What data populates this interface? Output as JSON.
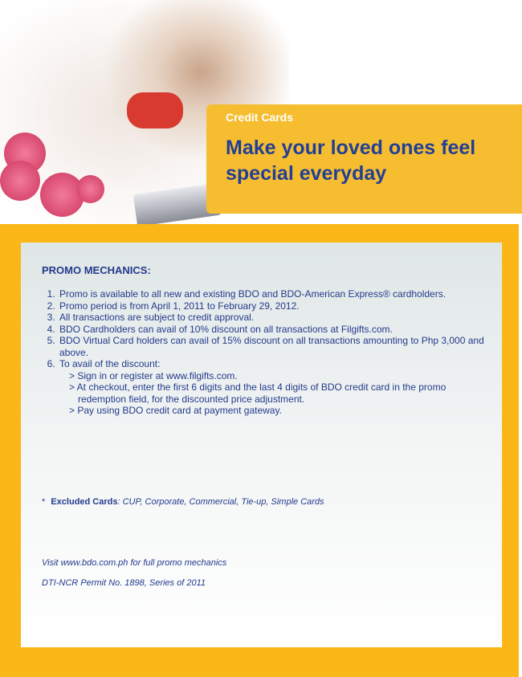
{
  "banner": {
    "kicker": "Credit Cards",
    "headline": "Make your loved ones feel special everyday"
  },
  "promo": {
    "heading": "PROMO MECHANICS:",
    "items": [
      "Promo is available to all new and existing BDO and BDO-American Express® cardholders.",
      "Promo period is from April 1, 2011 to February 29, 2012.",
      "All transactions are subject to credit approval.",
      "BDO Cardholders can avail of 10% discount on all transactions at Filgifts.com.",
      "BDO Virtual Card holders can avail of 15% discount on all transactions amounting to Php 3,000 and above.",
      "To avail of the discount:"
    ],
    "steps": [
      "> Sign in or register at www.filgifts.com.",
      "> At checkout, enter the first 6 digits and the last 4 digits of BDO credit card in the promo redemption field, for the discounted price adjustment.",
      "> Pay using BDO credit card at payment gateway."
    ],
    "excluded_marker": "*",
    "excluded_label": "Excluded Cards",
    "excluded_value": ": CUP, Corporate, Commercial, Tie-up, Simple Cards",
    "visit": "Visit www.bdo.com.ph for full promo mechanics",
    "permit": "DTI-NCR Permit No. 1898, Series of 2011"
  },
  "colors": {
    "banner": "#f5bd2f",
    "frame": "#fbb617",
    "text": "#233a8c"
  }
}
